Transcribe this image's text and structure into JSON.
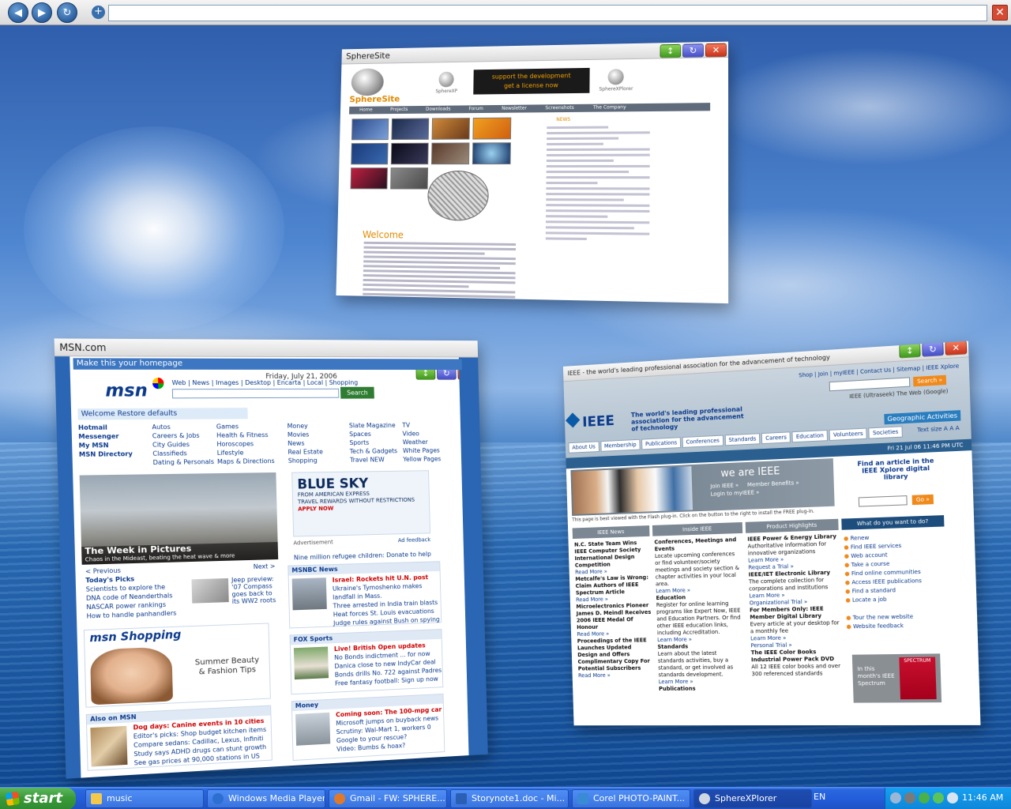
{
  "browser": {
    "address": "",
    "nav_back": "◀",
    "nav_forward": "▶",
    "nav_reload": "↻",
    "tab_add": "+",
    "close": "✕"
  },
  "windows": {
    "sphere": {
      "title": "SphereSite",
      "logo": "SphereSite",
      "products": [
        "SphereXP",
        "SphereXPlorer"
      ],
      "banner_line1": "support the development",
      "banner_line2": "get a license now",
      "nav": [
        "Home",
        "Projects",
        "Downloads",
        "Forum",
        "Newsletter",
        "Screenshots",
        "The Company"
      ],
      "news_title": "NEWS",
      "welcome": "Welcome"
    },
    "msn": {
      "title": "MSN.com",
      "homepage_link": "Make this your homepage",
      "date": "Friday, July 21, 2006",
      "logo": "msn",
      "top_links": "Web | News | Images | Desktop | Encarta | Local | Shopping",
      "search_button": "Search web",
      "welcome": "Welcome   Restore defaults",
      "services": [
        "Hotmail",
        "Autos",
        "Games",
        "Money",
        "Slate Magazine",
        "TV",
        "Messenger",
        "Careers & Jobs",
        "Health & Fitness",
        "Movies",
        "Spaces",
        "Video",
        "My MSN",
        "City Guides",
        "Horoscopes",
        "News",
        "Sports",
        "Weather",
        "MSN Directory",
        "Classifieds",
        "Lifestyle",
        "Real Estate",
        "Tech & Gadgets",
        "White Pages",
        "",
        "Dating & Personals",
        "Maps & Directions",
        "Shopping",
        "Travel NEW",
        "Yellow Pages"
      ],
      "photo_title": "The Week in Pictures",
      "photo_sub": "Chaos in the Mideast, beating the heat wave & more",
      "prev": "< Previous",
      "next": "Next >",
      "ad_big": "BLUE SKY",
      "ad_sub": "FROM AMERICAN EXPRESS",
      "ad_sub2": "TRAVEL REWARDS WITHOUT RESTRICTIONS",
      "ad_apply": "APPLY NOW",
      "ad_label": "Advertisement",
      "ad_feedback": "Ad feedback",
      "refugee": "Nine million refugee children: Donate to help",
      "todays_picks_title": "Today's Picks",
      "todays_picks": [
        "Scientists to explore the DNA code of Neanderthals",
        "NASCAR power rankings",
        "How to handle panhandlers"
      ],
      "jeep": "Jeep preview: '07 Compass goes back to its WW2 roots",
      "nbc_title": "MSNBC News",
      "nbc_items": [
        "Israel: Rockets hit U.N. post",
        "Ukraine's Tymoshenko makes landfall in Mass.",
        "Three arrested in India train blasts",
        "Heat forces St. Louis evacuations",
        "Judge rules against Bush on spying"
      ],
      "shop_logo": "msn Shopping",
      "shop_text": "Summer Beauty & Fashion Tips",
      "fox_title": "FOX Sports",
      "fox_items": [
        "Live! British Open updates",
        "No Bonds indictment ... for now",
        "Danica close to new IndyCar deal",
        "Bonds drills No. 722 against Padres",
        "Free fantasy football: Sign up now"
      ],
      "also_title": "Also on MSN",
      "also_items": [
        "Dog days: Canine events in 10 cities",
        "Editor's picks: Shop budget kitchen items",
        "Compare sedans: Cadillac, Lexus, Infiniti",
        "Study says ADHD drugs can stunt growth",
        "See gas prices at 90,000 stations in US"
      ],
      "money_title": "Money",
      "money_items": [
        "Coming soon: The 100-mpg car",
        "Microsoft jumps on buyback news",
        "Scrutiny: Wal-Mart 1, workers 0",
        "Google to your rescue?",
        "Video: Bumbs & hoax?"
      ]
    },
    "ieee": {
      "title": "IEEE - the world's leading professional association for the advancement of technology",
      "top_links": "Shop | Join | myIEEE | Contact Us | Sitemap | IEEE Xplore",
      "logo": "IEEE",
      "tagline": "The world's leading professional association for the advancement of technology",
      "search_button": "Search »",
      "radio": "IEEE (Ultraseek)   The Web (Google)",
      "tabs": [
        "About Us",
        "Membership",
        "Publications",
        "Conferences",
        "Standards",
        "Careers",
        "Education",
        "Volunteers",
        "Societies"
      ],
      "geo": "Geographic Activities",
      "text_size": "Text size  A A A",
      "date": "Fri 21 Jul 06 11:46 PM UTC",
      "we_are": "we are IEEE",
      "hero_links": "Join IEEE »     Member Benefits »\nLogin to myIEEE »",
      "find_article": "Find an article in the IEEE Xplore digital library",
      "go": "Go »",
      "flash": "This page is best viewed with the Flash plug-in. Click on the button to the right to install the FREE plug-in.",
      "col_heads": [
        "IEEE News",
        "Inside IEEE",
        "Product Highlights",
        "What do you want to do?"
      ],
      "news": [
        "N.C. State Team Wins IEEE Computer Society International Design Competition",
        "Read More »",
        "Metcalfe's Law is Wrong: Claim Authors of IEEE Spectrum Article",
        "Read More »",
        "Microelectronics Pioneer James D. Meindl Receives 2006 IEEE Medal Of Honour",
        "Read More »",
        "Proceedings of the IEEE Launches Updated Design and Offers Complimentary Copy For Potential Subscribers",
        "Read More »"
      ],
      "inside": [
        "Conferences, Meetings and Events",
        "Locate upcoming conferences or find volunteer/society meetings and society section & chapter activities in your local area.",
        "Learn More »",
        "Education",
        "Register for online learning programs like Expert Now, IEEE and Education Partners. Or find other IEEE education links, including Accreditation.",
        "Learn More »",
        "Standards",
        "Learn about the latest standards activities, buy a standard, or get involved as standards development.",
        "Learn More »",
        "Publications"
      ],
      "products": [
        "IEEE Power & Energy Library",
        "Authoritative information for innovative organizations",
        "Learn More »",
        "Request a Trial »",
        "IEEE/IET Electronic Library",
        "The complete collection for corporations and institutions",
        "Learn More »",
        "Organizational Trial »",
        "For Members Only: IEEE Member Digital Library",
        "Every article at your desktop for a monthly fee",
        "Learn More »",
        "Personal Trial »",
        "The IEEE Color Books Industrial Power Pack DVD",
        "All 12 IEEE color books and over 300 referenced standards"
      ],
      "actions": [
        "Renew",
        "Find IEEE services",
        "Web account",
        "Take a course",
        "Find online communities",
        "Access IEEE publications",
        "Find a standard",
        "Locate a job",
        "",
        "Tour the new website",
        "Website feedback"
      ],
      "spectrum_text": "In this month's IEEE Spectrum",
      "spectrum_cover": "SPECTRUM"
    }
  },
  "taskbar": {
    "start": "start",
    "items": [
      {
        "label": "music",
        "color": "#f3c94b"
      },
      {
        "label": "Windows Media Player",
        "color": "#2c6fd1"
      },
      {
        "label": "Gmail - FW: SPHERE...",
        "color": "#e07a2a"
      },
      {
        "label": "Storynote1.doc - Mi...",
        "color": "#2b5fb3"
      },
      {
        "label": "Corel PHOTO-PAINT...",
        "color": "#3a8bd6"
      },
      {
        "label": "SphereXPlorer",
        "color": "#cfd7e3"
      }
    ],
    "language": "EN",
    "clock": "11:46 AM"
  }
}
